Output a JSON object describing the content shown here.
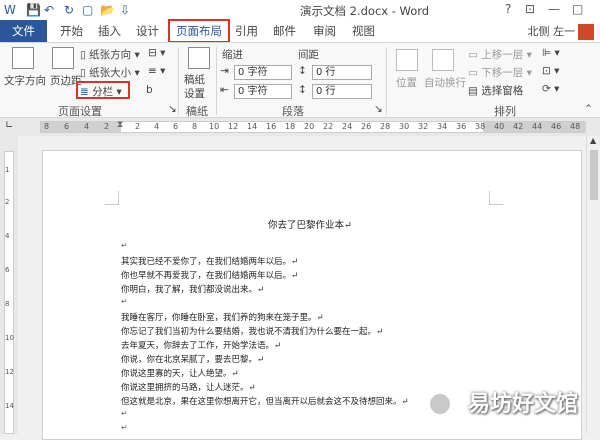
{
  "window": {
    "title": "演示文档 2.docx - Word",
    "controls": [
      "?",
      "⊡",
      "—",
      "□"
    ]
  },
  "tabs": {
    "file": "文件",
    "items": [
      "开始",
      "插入",
      "设计",
      "页面布局",
      "引用",
      "邮件",
      "审阅",
      "视图"
    ],
    "active": "页面布局"
  },
  "user": "北侧 左一",
  "ribbon": {
    "text_direction": "文字方向",
    "margins": "页边距",
    "orientation": "纸张方向",
    "size": "纸张大小",
    "columns": "分栏",
    "breaks": "b",
    "page_setup_label": "页面设置",
    "draft_paper": "稿纸\n设置",
    "draft_label": "稿纸",
    "indent_label": "缩进",
    "spacing_label": "间距",
    "indent_left": "0 字符",
    "indent_right": "0 字符",
    "space_before": "0 行",
    "space_after": "0 行",
    "paragraph_label": "段落",
    "position": "位置",
    "wrap_text": "自动换行",
    "bring_forward": "上移一层",
    "send_backward": "下移一层",
    "selection_pane": "选择窗格",
    "arrange_label": "排列"
  },
  "ruler": {
    "numbers": [
      "8",
      "6",
      "4",
      "2",
      "2",
      "4",
      "6",
      "8",
      "10",
      "12",
      "14",
      "16",
      "18",
      "20",
      "22",
      "24",
      "26",
      "28",
      "30",
      "32",
      "34",
      "36",
      "38",
      "40",
      "42",
      "44",
      "46",
      "48"
    ],
    "vertical": [
      "1",
      "2",
      "4",
      "6",
      "8",
      "10",
      "12",
      "14"
    ]
  },
  "document": {
    "title": "你去了巴黎作业本↵",
    "mark": "↵",
    "lines": [
      "其实我已经不爱你了，在我们结婚两年以后。↵",
      "你也早就不再爱我了，在我们结婚两年以后。↵",
      "你明白，我了解，我们都没说出来。↵",
      "我睡在客厅，你睡在卧室，我们养的狗来在笼子里。↵",
      "你忘记了我们当初为什么要结婚，我也说不清我们为什么要在一起。↵",
      "去年夏天，你辞去了工作，开始学法语。↵",
      "你说，你在北京呆腻了，要去巴黎。↵",
      "你说这里寡的天，让人绝望。↵",
      "你说这里拥挤的马路，让人迷茫。↵",
      "但这就是北京，果在这里你想离开它，但当离开以后就会这不及待想回来。↵"
    ]
  },
  "watermark": "易坊好文馆"
}
